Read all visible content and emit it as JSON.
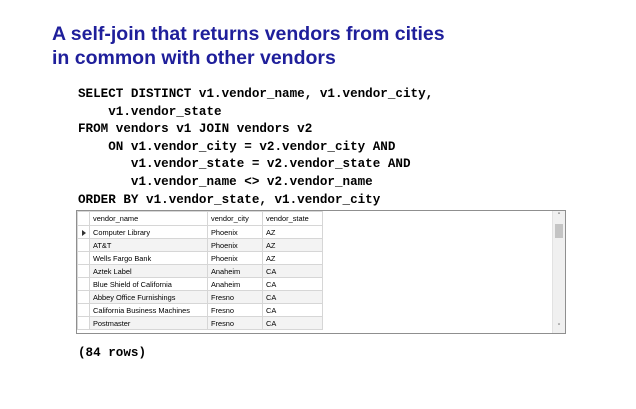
{
  "title": {
    "line1": "A self-join that returns vendors from cities",
    "line2": "in common with other vendors"
  },
  "sql": {
    "lines": [
      "SELECT DISTINCT v1.vendor_name, v1.vendor_city,",
      "    v1.vendor_state",
      "FROM vendors v1 JOIN vendors v2",
      "    ON v1.vendor_city = v2.vendor_city AND",
      "       v1.vendor_state = v2.vendor_state AND",
      "       v1.vendor_name <> v2.vendor_name",
      "ORDER BY v1.vendor_state, v1.vendor_city"
    ]
  },
  "results": {
    "columns": [
      "vendor_name",
      "vendor_city",
      "vendor_state"
    ],
    "current_row_icon": "row-pointer-icon",
    "rows": [
      [
        "Computer Library",
        "Phoenix",
        "AZ"
      ],
      [
        "AT&T",
        "Phoenix",
        "AZ"
      ],
      [
        "Wells Fargo Bank",
        "Phoenix",
        "AZ"
      ],
      [
        "Aztek Label",
        "Anaheim",
        "CA"
      ],
      [
        "Blue Shield of California",
        "Anaheim",
        "CA"
      ],
      [
        "Abbey Office Furnishings",
        "Fresno",
        "CA"
      ],
      [
        "California Business Machines",
        "Fresno",
        "CA"
      ],
      [
        "Postmaster",
        "Fresno",
        "CA"
      ]
    ]
  },
  "scrollbar": {
    "up_icon": "scroll-up-icon",
    "down_icon": "scroll-down-icon",
    "up_glyph": "˄",
    "down_glyph": "˅"
  },
  "row_count": "(84 rows)",
  "colors": {
    "title": "#1f1f9b",
    "grid_border": "#8f8f8f",
    "alt_row": "#f3f3f3"
  }
}
